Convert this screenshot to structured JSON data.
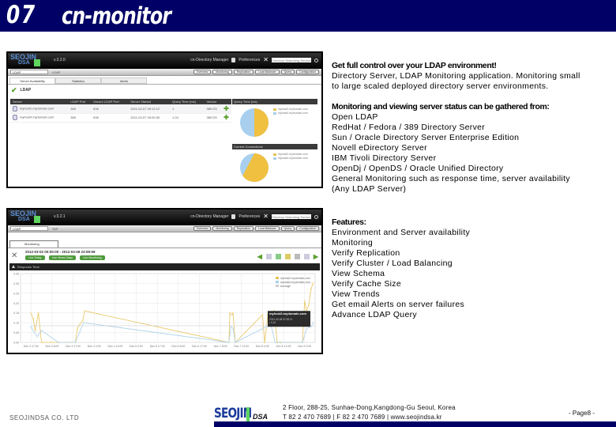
{
  "banner": {
    "number": "07",
    "title": "cn-monitor"
  },
  "screenshot1": {
    "logo_top": "SEOJIN",
    "logo_bottom": "DSA",
    "version": "v.3.2.0",
    "manager_label": "cn-Directory Manager",
    "preferences_label": "Preferences",
    "search_placeholder": "Directory Searching Service",
    "select_value": "LDAP",
    "select_label": "LDAP",
    "nav_buttons": [
      "Overview",
      "Monitoring",
      "Replication",
      "Load Balancer",
      "Query",
      "Configuration"
    ],
    "tabs": [
      "Server Availability",
      "Statistics",
      "Alerts"
    ],
    "section_title": "LDAP",
    "table": {
      "headers": [
        "Server",
        "LDAP Port",
        "Secure LDAP Port",
        "Server Started",
        "Query Time (ms)",
        "Vendor"
      ],
      "rows": [
        [
          "myhost2.mydomain.com",
          "389",
          "636",
          "2011-02-07 09:12:12",
          "1",
          "389 DS"
        ],
        [
          "myhost4.mydomain.com",
          "389",
          "636",
          "2011-02-07 09:00:30",
          "1.04",
          "389 DS"
        ]
      ]
    },
    "pie1": {
      "title": "Query Time (ms)",
      "legend": [
        "myhost2.mydomain.com",
        "myhost4.mydomain.com"
      ]
    },
    "pie2": {
      "title": "Current Connections",
      "legend": [
        "myhost2.mydomain.com",
        "myhost4.mydomain.com"
      ]
    }
  },
  "screenshot2": {
    "logo_top": "SEOJIN",
    "logo_bottom": "DSA",
    "version": "v.3.2.1",
    "manager_label": "cn-Directory Manager",
    "preferences_label": "Preferences",
    "search_placeholder": "Directory Searching Service",
    "select_value": "LDAP",
    "select_label": "TAP",
    "nav_buttons": [
      "Overview",
      "Monitoring",
      "Replication",
      "Load Balancer",
      "Query",
      "Configuration"
    ],
    "tab": "Monitoring",
    "date_range": "2012-03-02 00:00:00 - 2012-03-08 23:59:59",
    "action_buttons": [
      "Live Today",
      "Live Seven Days",
      "Live Monitoring"
    ],
    "chart_title": "Response Time",
    "tooltip": {
      "host": "myhost2.mydomain.com",
      "time": "2012-03-08 07:00:11",
      "value": "0.14"
    }
  },
  "chart_data": {
    "type": "line",
    "title": "Response Time",
    "xlabel": "",
    "ylabel": "",
    "ylim": [
      0,
      0.35
    ],
    "yticks": [
      "0.00",
      "0.05",
      "0.10",
      "0.15",
      "0.20",
      "0.25",
      "0.30",
      "0.35"
    ],
    "categories": [
      "Dec 3 17:00",
      "Dec 3 8:00",
      "Dec 3 17:00",
      "Dec 4 0:00",
      "Dec 4 12:00",
      "Dec 5 0:00",
      "Dec 5 17:00",
      "Dec 6 8:00",
      "Dec 6 17:00",
      "Dec 7 8:00",
      "Dec 7 12:00",
      "Dec 8 0:00",
      "Dec 8 12:00",
      "Dec 9 0:00"
    ],
    "series": [
      {
        "name": "myhost2.mydomain.com",
        "color": "#e6c35a",
        "x": [
          0,
          0.1,
          0.2,
          0.35,
          0.5,
          1.3,
          2.1,
          2.2,
          2.3,
          2.45,
          2.55,
          9.4,
          9.45,
          9.55,
          9.6,
          9.7,
          11.0,
          11.1,
          11.25,
          11.4,
          11.55,
          11.7,
          11.85,
          12.9,
          13.0,
          13.1,
          13.2,
          13.3,
          13.4
        ],
        "values": [
          0.15,
          0.12,
          0.06,
          0.15,
          0.0,
          0.0,
          0.0,
          0.07,
          0.09,
          0.11,
          0.16,
          0.0,
          0.15,
          0.14,
          0.15,
          0.0,
          0.14,
          0.0,
          0.14,
          0.15,
          0.16,
          0.0,
          0.0,
          0.0,
          0.21,
          0.16,
          0.19,
          0.27,
          0.3
        ]
      },
      {
        "name": "myhost4.mydomain.com",
        "color": "#a8cfe8",
        "x": [
          0,
          0.15,
          0.3,
          0.5,
          1.3,
          2.1,
          2.3,
          2.5,
          9.4,
          9.5,
          9.6,
          9.7,
          11.0,
          11.2,
          11.4,
          11.6,
          12.9,
          13.1,
          13.3,
          13.4
        ],
        "values": [
          0.08,
          0.05,
          0.03,
          0.06,
          0.0,
          0.0,
          0.05,
          0.1,
          0.0,
          0.08,
          0.07,
          0.0,
          0.07,
          0.08,
          0.09,
          0.0,
          0.0,
          0.07,
          0.08,
          0.1
        ]
      },
      {
        "name": "Average",
        "color": "#cccccc",
        "x": [
          0,
          13.5
        ],
        "values": [
          0.085,
          0.085
        ]
      }
    ],
    "legend": "top-right",
    "grid": true
  },
  "descriptions": {
    "intro_heading": "Get full control over your LDAP environment!",
    "intro_lines": [
      "Directory Server, LDAP Monitoring application. Monitoring small",
      "to large scaled deployed directory server environments."
    ],
    "sources_heading": "Monitoring and viewing server status can be gathered from:",
    "sources": [
      "Open LDAP",
      "RedHat / Fedora / 389 Directory Server",
      "Sun / Oracle Directory Server Enterprise Edition",
      "Novell eDirectory Server",
      "IBM Tivoli Directory Server",
      "OpenDj / OpenDS / Oracle Unified Directory",
      "General Monitoring such as response time, server availability",
      "(Any LDAP Server)"
    ],
    "features_heading": "Features:",
    "features": [
      "Environment and Server availability",
      "Monitoring",
      "Verify Replication",
      "Verify Cluster / Load Balancing",
      "View Schema",
      "Verify Cache Size",
      "View Trends",
      "Get email Alerts on server failures",
      "Advance LDAP Query"
    ]
  },
  "footer": {
    "company": "SEOJINDSA CO. LTD",
    "logo_main": "SEOJIN",
    "logo_sub": "DSA",
    "address": "2 Floor, 288-25, Sunhae-Dong,Kangdong-Gu Seoul, Korea",
    "contact": "T 82 2 470 7689 | F 82 2 470 7689 | www.seojindsa.kr",
    "page": "- Page8 -"
  },
  "colors": {
    "banner": "#000066",
    "series_gold": "#e6c35a",
    "series_blue": "#a8cfe8",
    "accent_green": "#5ed55e"
  }
}
